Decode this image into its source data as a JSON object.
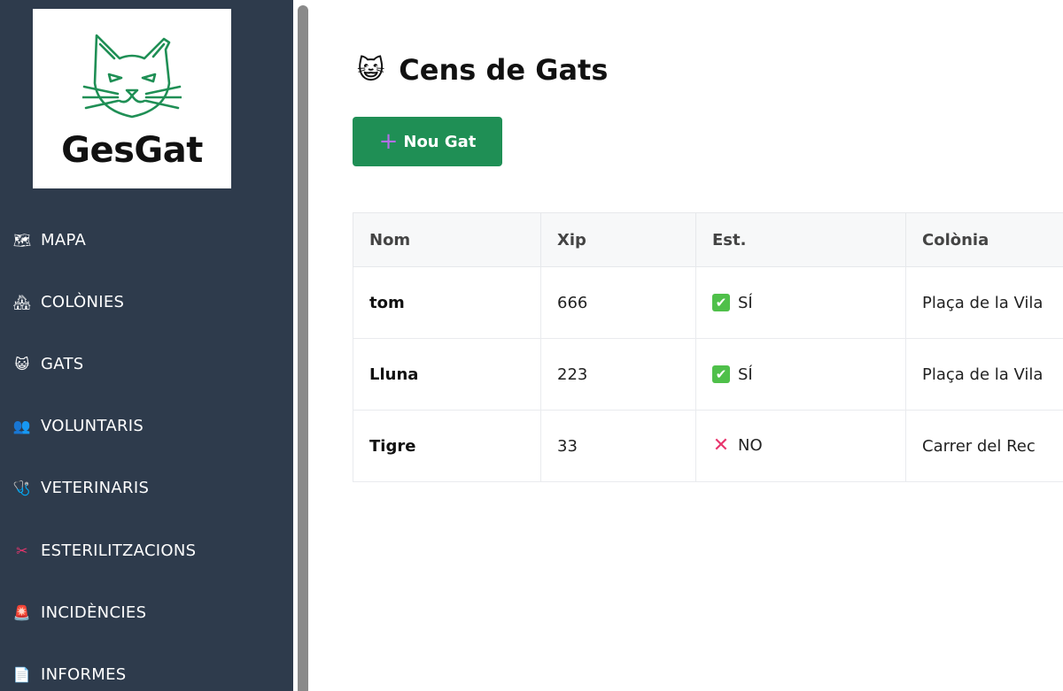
{
  "brand": {
    "name": "GesGat",
    "logo_color": "#1f8f55"
  },
  "sidebar": {
    "items": [
      {
        "label": "MAPA",
        "icon": "map-icon",
        "glyph": "🗺"
      },
      {
        "label": "COLÒNIES",
        "icon": "houses-icon",
        "glyph": "🏘"
      },
      {
        "label": "GATS",
        "icon": "cat-face-icon",
        "glyph": "😺"
      },
      {
        "label": "VOLUNTARIS",
        "icon": "people-icon",
        "glyph": "👥"
      },
      {
        "label": "VETERINARIS",
        "icon": "stethoscope-icon",
        "glyph": "🩺"
      },
      {
        "label": "ESTERILITZACIONS",
        "icon": "scissors-icon",
        "glyph": "✂"
      },
      {
        "label": "INCIDÈNCIES",
        "icon": "siren-icon",
        "glyph": "🚨"
      },
      {
        "label": "INFORMES",
        "icon": "document-icon",
        "glyph": "📄"
      }
    ]
  },
  "main": {
    "title": "Cens de Gats",
    "title_icon": "😺",
    "new_button": {
      "label": "Nou Gat",
      "icon": "+"
    },
    "table": {
      "headers": [
        "Nom",
        "Xip",
        "Est.",
        "Colònia"
      ],
      "rows": [
        {
          "nom": "tom",
          "xip": "666",
          "est": "SÍ",
          "est_icon": "✔",
          "colonia": "Plaça de la Vila"
        },
        {
          "nom": "Lluna",
          "xip": "223",
          "est": "SÍ",
          "est_icon": "✔",
          "colonia": "Plaça de la Vila"
        },
        {
          "nom": "Tigre",
          "xip": "33",
          "est": "NO",
          "est_icon": "✕",
          "colonia": "Carrer del Rec"
        }
      ]
    }
  },
  "colors": {
    "sidebar_bg": "#2e3b4c",
    "accent": "#1f8f55",
    "yes": "#4fc04a",
    "no": "#e8356d"
  }
}
